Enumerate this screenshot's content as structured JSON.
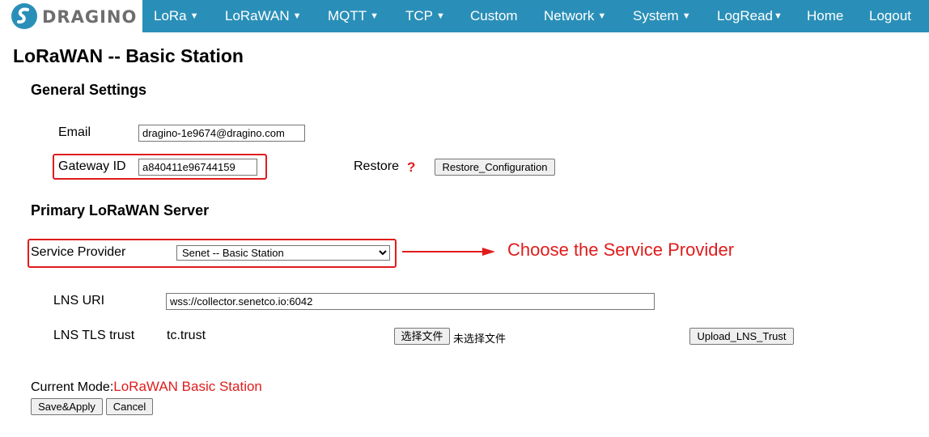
{
  "nav": {
    "brand": "DRAGINO",
    "items": [
      {
        "label": "LoRa",
        "caret": "▼"
      },
      {
        "label": "LoRaWAN",
        "caret": "▼"
      },
      {
        "label": "MQTT",
        "caret": "▼"
      },
      {
        "label": "TCP",
        "caret": "▼"
      },
      {
        "label": "Custom",
        "caret": ""
      },
      {
        "label": "Network",
        "caret": "▼"
      },
      {
        "label": "System",
        "caret": "▼"
      },
      {
        "label": "LogRead",
        "caret": "▼"
      },
      {
        "label": "Home",
        "caret": ""
      },
      {
        "label": "Logout",
        "caret": ""
      }
    ]
  },
  "page": {
    "title": "LoRaWAN -- Basic Station"
  },
  "general": {
    "title": "General Settings",
    "email_label": "Email",
    "email_value": "dragino-1e9674@dragino.com",
    "gateway_label": "Gateway ID",
    "gateway_value": "a840411e96744159",
    "restore_label": "Restore",
    "restore_help": "?",
    "restore_button": "Restore_Configuration"
  },
  "server": {
    "title": "Primary LoRaWAN Server",
    "provider_label": "Service Provider",
    "provider_selected": "Senet -- Basic Station",
    "annotation": "Choose the Service Provider",
    "lns_uri_label": "LNS URI",
    "lns_uri_value": "wss://collector.senetco.io:6042",
    "tls_label": "LNS TLS trust",
    "tls_file": "tc.trust",
    "choose_file_button": "选择文件",
    "no_file_text": "未选择文件",
    "upload_button": "Upload_LNS_Trust"
  },
  "footer": {
    "mode_label": "Current Mode:",
    "mode_value": "LoRaWAN Basic Station",
    "save_button": "Save&Apply",
    "cancel_button": "Cancel"
  },
  "colors": {
    "navbar": "#2a8fb8",
    "annotation": "#e01c1c"
  }
}
